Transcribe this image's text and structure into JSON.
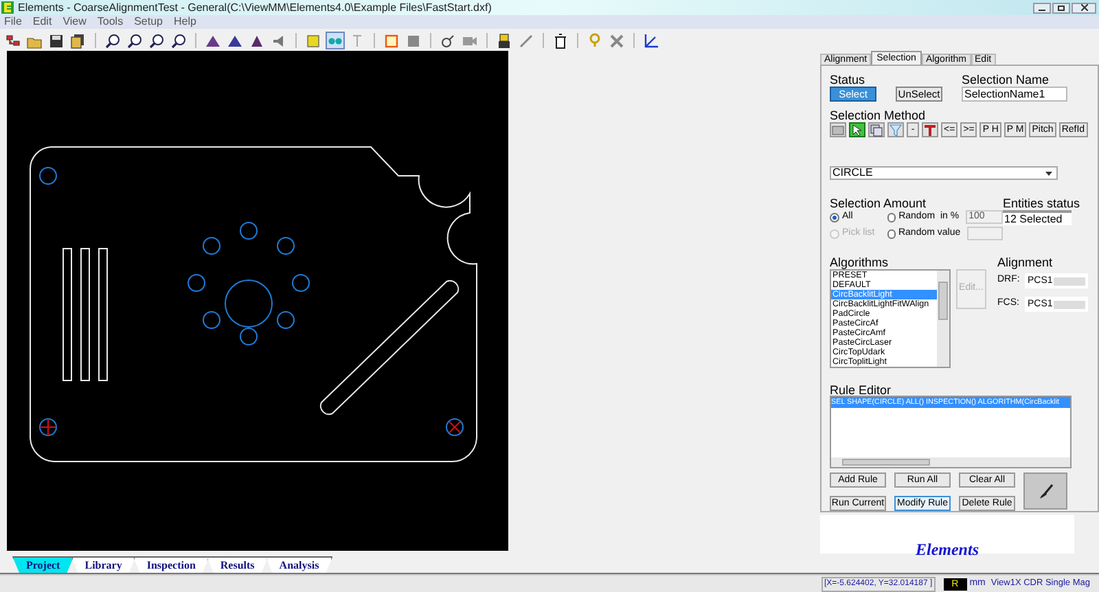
{
  "window": {
    "title": "Elements - CoarseAlignmentTest - General(C:\\ViewMM\\Elements4.0\\Example Files\\FastStart.dxf)"
  },
  "menu": [
    "File",
    "Edit",
    "View",
    "Tools",
    "Setup",
    "Help"
  ],
  "toolbar": [
    {
      "selected": false
    },
    {
      "selected": false
    },
    {
      "selected": false
    },
    {
      "selected": false
    },
    {
      "selected": false
    },
    {
      "selected": false
    },
    {
      "selected": false
    },
    {
      "selected": false
    },
    {
      "selected": false
    },
    {
      "selected": false
    },
    {
      "selected": false
    },
    {
      "selected": false
    },
    {
      "selected": false
    },
    {
      "selected": true
    },
    {
      "selected": false
    },
    {
      "selected": false
    },
    {
      "selected": false
    },
    {
      "selected": false
    },
    {
      "selected": false
    },
    {
      "selected": false
    },
    {
      "selected": false
    },
    {
      "selected": false
    },
    {
      "selected": false
    },
    {
      "selected": false
    },
    {
      "selected": false
    }
  ],
  "panel": {
    "tabs": [
      {
        "label": "Alignment",
        "selected": false
      },
      {
        "label": "Selection",
        "selected": true
      },
      {
        "label": "Algorithm",
        "selected": false
      },
      {
        "label": "Edit",
        "selected": false
      }
    ],
    "status": {
      "label": "Status",
      "buttons": [
        {
          "label": "Select",
          "selected": true
        },
        {
          "label": "UnSelect",
          "selected": false
        }
      ]
    },
    "selection_name": {
      "label": "Selection Name",
      "value": "SelectionName1"
    },
    "selection_method": {
      "label": "Selection Method",
      "buttons": [
        {
          "kind": "icon",
          "selected": false
        },
        {
          "kind": "icon",
          "selected": true
        },
        {
          "kind": "icon",
          "selected": false
        },
        {
          "kind": "icon",
          "selected": false
        },
        {
          "kind": "text",
          "label": "-",
          "selected": false
        },
        {
          "kind": "icon",
          "selected": false
        },
        {
          "kind": "text",
          "label": "<=",
          "selected": false
        },
        {
          "kind": "text",
          "label": ">=",
          "selected": false
        },
        {
          "kind": "text",
          "label": "P H",
          "selected": false
        },
        {
          "kind": "text",
          "label": "P M",
          "selected": false
        },
        {
          "kind": "text",
          "label": "Pitch",
          "selected": false
        },
        {
          "kind": "text",
          "label": "RefId",
          "selected": false
        }
      ],
      "shape": "CIRCLE"
    },
    "selection_amount": {
      "label": "Selection Amount",
      "options": [
        {
          "label": "All",
          "selected": true,
          "disabled": false
        },
        {
          "label": "Random  in %",
          "selected": false,
          "disabled": false,
          "value": "100"
        },
        {
          "label": "Pick list",
          "selected": false,
          "disabled": true
        },
        {
          "label": "Random value",
          "selected": false,
          "disabled": false
        }
      ]
    },
    "entities_status": {
      "label": "Entities status",
      "value": "12 Selected"
    },
    "algorithms": {
      "label": "Algorithms",
      "items": [
        {
          "label": "PRESET",
          "selected": false
        },
        {
          "label": "DEFAULT",
          "selected": false
        },
        {
          "label": "CircBacklitLight",
          "selected": true
        },
        {
          "label": "CircBacklitLightFitWAlign",
          "selected": false
        },
        {
          "label": "PadCircle",
          "selected": false
        },
        {
          "label": "PasteCircAf",
          "selected": false
        },
        {
          "label": "PasteCircAmf",
          "selected": false
        },
        {
          "label": "PasteCircLaser",
          "selected": false
        },
        {
          "label": "CircTopUdark",
          "selected": false
        },
        {
          "label": "CircToplitLight",
          "selected": false
        }
      ],
      "edit_button": {
        "label": "Edit...",
        "disabled": true
      }
    },
    "alignment": {
      "label": "Alignment",
      "fields": [
        {
          "label": "DRF:",
          "value": "PCS1"
        },
        {
          "label": "FCS:",
          "value": "PCS1"
        }
      ]
    },
    "rule_editor": {
      "label": "Rule Editor",
      "rules": [
        {
          "text": "SEL SHAPE(CIRCLE) ALL() INSPECTION() ALGORITHM(CircBacklit",
          "selected": true
        }
      ]
    },
    "buttons": [
      {
        "label": "Add Rule",
        "focused": false
      },
      {
        "label": "Run All",
        "focused": false
      },
      {
        "label": "Clear All",
        "focused": false
      },
      {
        "label": "Run Current",
        "focused": false
      },
      {
        "label": "Modify Rule",
        "focused": true
      },
      {
        "label": "Delete Rule",
        "focused": false
      }
    ]
  },
  "logo_text": "Elements",
  "bottom_tabs": [
    {
      "label": "Project",
      "selected": true
    },
    {
      "label": "Library",
      "selected": false
    },
    {
      "label": "Inspection",
      "selected": false
    },
    {
      "label": "Results",
      "selected": false
    },
    {
      "label": "Analysis",
      "selected": false
    }
  ],
  "status_bar": {
    "coordinates": "[X=-5.624402, Y=32.014187 ]",
    "mode": "R",
    "units": "mm",
    "view": "View1X CDR Single Mag"
  }
}
